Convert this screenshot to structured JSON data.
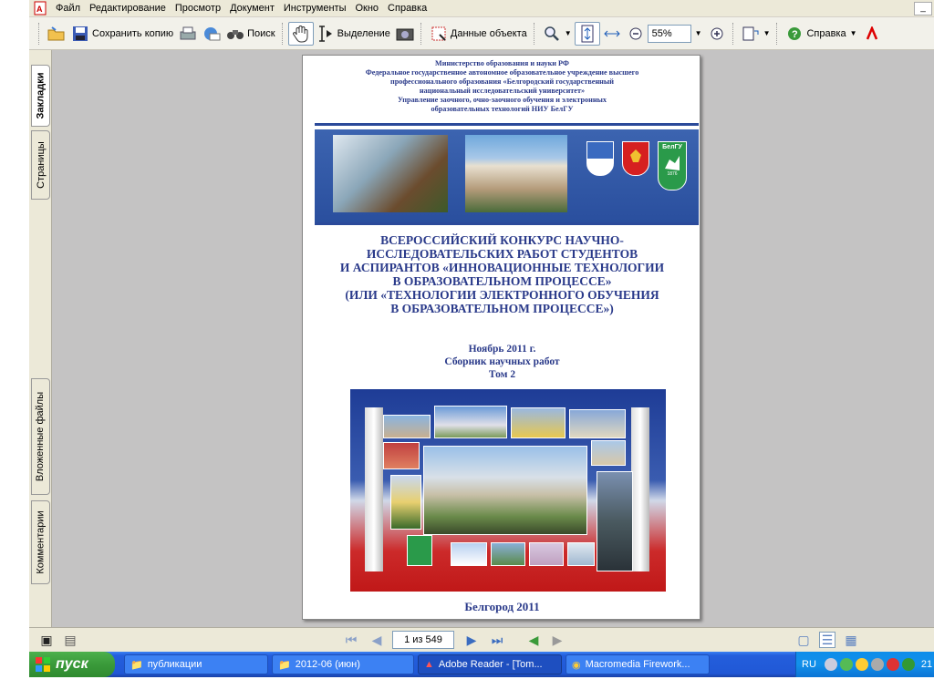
{
  "menubar": {
    "items": [
      "Файл",
      "Редактирование",
      "Просмотр",
      "Документ",
      "Инструменты",
      "Окно",
      "Справка"
    ],
    "minimize_label": "_"
  },
  "toolbar": {
    "save_copy": "Сохранить копию",
    "search": "Поиск",
    "select": "Выделение",
    "object_data": "Данные объекта",
    "zoom_value": "55%",
    "help": "Справка"
  },
  "sidepanel": {
    "tabs": [
      "Закладки",
      "Страницы",
      "Вложенные файлы",
      "Комментарии"
    ]
  },
  "document": {
    "header_lines": [
      "Министерство образования и науки РФ",
      "Федеральное государственное автономное образовательное учреждение высшего",
      "профессионального образования «Белгородский государственный",
      "национальный исследовательский университет»",
      "Управление заочного, очно-заочного обучения и электронных",
      "образовательных технологий НИУ БелГУ"
    ],
    "emblem_text": "БелГУ",
    "emblem_year": "1876",
    "title_lines": [
      "ВСЕРОССИЙСКИЙ КОНКУРС НАУЧНО-",
      "ИССЛЕДОВАТЕЛЬСКИХ РАБОТ СТУДЕНТОВ",
      "И АСПИРАНТОВ «ИННОВАЦИОННЫЕ ТЕХНОЛОГИИ",
      "В ОБРАЗОВАТЕЛЬНОМ ПРОЦЕССЕ»",
      "(ИЛИ «ТЕХНОЛОГИИ ЭЛЕКТРОННОГО ОБУЧЕНИЯ",
      "В ОБРАЗОВАТЕЛЬНОМ ПРОЦЕССЕ»)"
    ],
    "date": "Ноябрь 2011 г.",
    "collection": "Сборник научных работ",
    "volume": "Том 2",
    "footer": "Белгород 2011"
  },
  "navbar": {
    "page_value": "1 из 549"
  },
  "taskbar": {
    "start_label": "пуск",
    "tasks": [
      "публикации",
      "2012-06 (июн)",
      "Adobe Reader - [Tom...",
      "Macromedia Firework..."
    ],
    "language": "RU",
    "clock": "21"
  },
  "colors": {
    "doc_blue": "#2a3a8a",
    "taskbar_blue": "#245edc",
    "start_green": "#3a9a3a"
  }
}
